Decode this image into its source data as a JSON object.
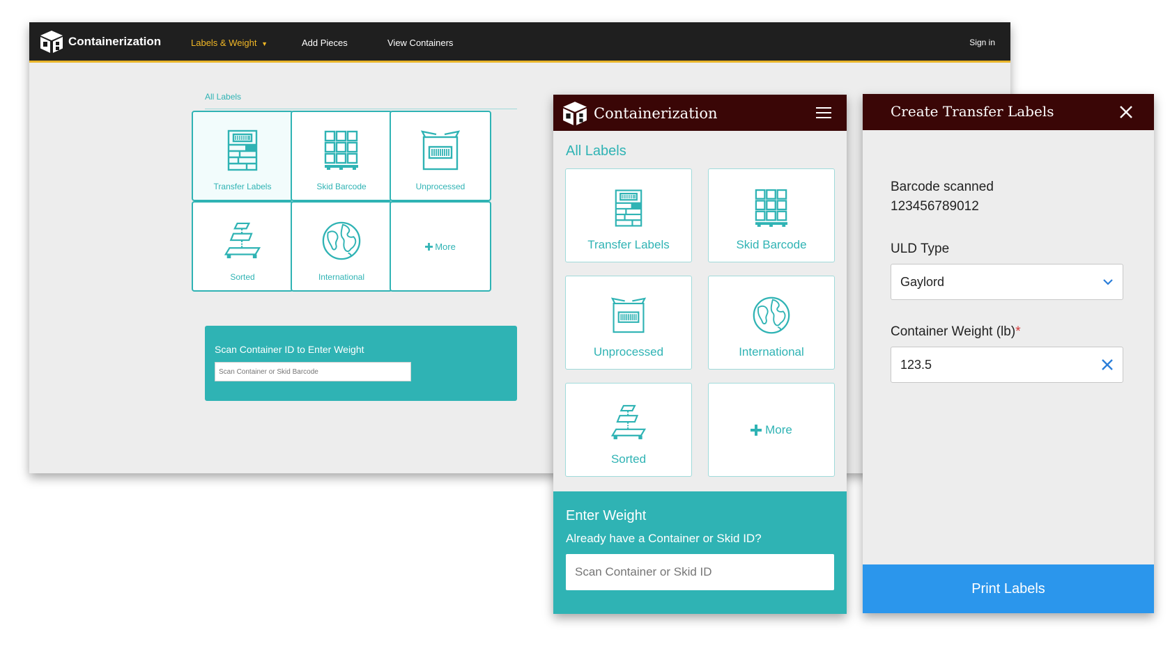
{
  "desktop": {
    "brand": "Containerization",
    "menu": {
      "labels_weight": "Labels & Weight",
      "add_pieces": "Add Pieces",
      "view_containers": "View Containers",
      "sign_in": "Sign in"
    },
    "section_title": "All Labels",
    "tiles": {
      "transfer": "Transfer Labels",
      "skid": "Skid Barcode",
      "unprocessed": "Unprocessed",
      "sorted": "Sorted",
      "international": "International",
      "more": "More"
    },
    "scan": {
      "title": "Scan Container ID to Enter Weight",
      "placeholder": "Scan Container or Skid Barcode"
    }
  },
  "mobile": {
    "brand": "Containerization",
    "section_title": "All Labels",
    "tiles": {
      "transfer": "Transfer Labels",
      "skid": "Skid Barcode",
      "unprocessed": "Unprocessed",
      "international": "International",
      "sorted": "Sorted",
      "more": "More"
    },
    "weight": {
      "title": "Enter Weight",
      "subtitle": "Already have a Container or Skid ID?",
      "placeholder": "Scan Container or Skid ID"
    }
  },
  "dialog": {
    "title": "Create Transfer Labels",
    "barcode_label": "Barcode scanned",
    "barcode_value": "123456789012",
    "uld_label": "ULD Type",
    "uld_value": "Gaylord",
    "weight_label": "Container Weight (lb)",
    "required_mark": "*",
    "weight_value": "123.5",
    "print_button": "Print Labels"
  },
  "colors": {
    "teal": "#2fb3b4",
    "desktop_nav": "#1f1f1f",
    "desktop_accent": "#e9b52a",
    "mobile_nav": "#3a0606",
    "print_button": "#2b96ec",
    "required": "#d43a3a"
  },
  "icons": {
    "brand": "container-cube-icon",
    "transfer": "transfer-labels-icon",
    "skid": "skid-barcode-icon",
    "unprocessed": "unprocessed-box-icon",
    "sorted": "sorted-stack-icon",
    "international": "globe-icon",
    "more": "plus-icon",
    "menu": "hamburger-menu-icon",
    "close": "close-icon",
    "dropdown": "chevron-down-icon",
    "clear": "clear-x-icon"
  }
}
